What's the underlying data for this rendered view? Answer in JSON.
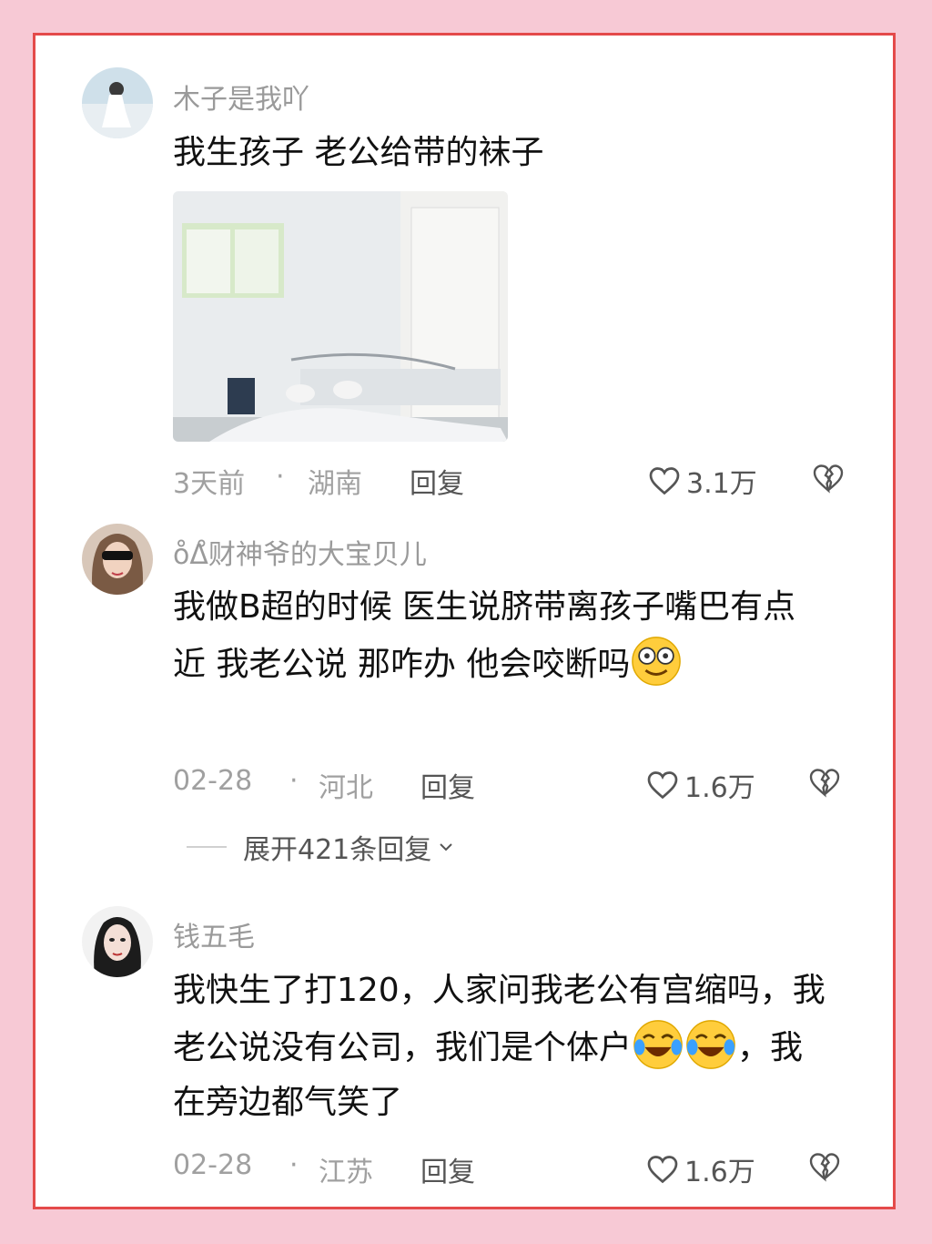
{
  "comments": [
    {
      "username": "木子是我吖",
      "text": "我生孩子 老公给带的袜子",
      "time": "3天前",
      "location": "湖南",
      "reply": "回复",
      "likes": "3.1万"
    },
    {
      "username": "o̊Δ̊财神爷的大宝贝儿",
      "text": "我做B超的时候  医生说脐带离孩子嘴巴有点近  我老公说  那咋办 他会咬断吗",
      "time": "02-28",
      "location": "河北",
      "reply": "回复",
      "likes": "1.6万",
      "expand": "展开421条回复"
    },
    {
      "username": "钱五毛",
      "text_line1": "我快生了打120，人家问我老公有宫缩吗，我老公说没有公司，我们是个体户",
      "text_line2": "，我在旁边都气笑了",
      "time": "02-28",
      "location": "江苏",
      "reply": "回复",
      "likes": "1.6万"
    }
  ],
  "separator": "·",
  "colors": {
    "background": "#f7c9d5",
    "border": "#e44a4a"
  }
}
